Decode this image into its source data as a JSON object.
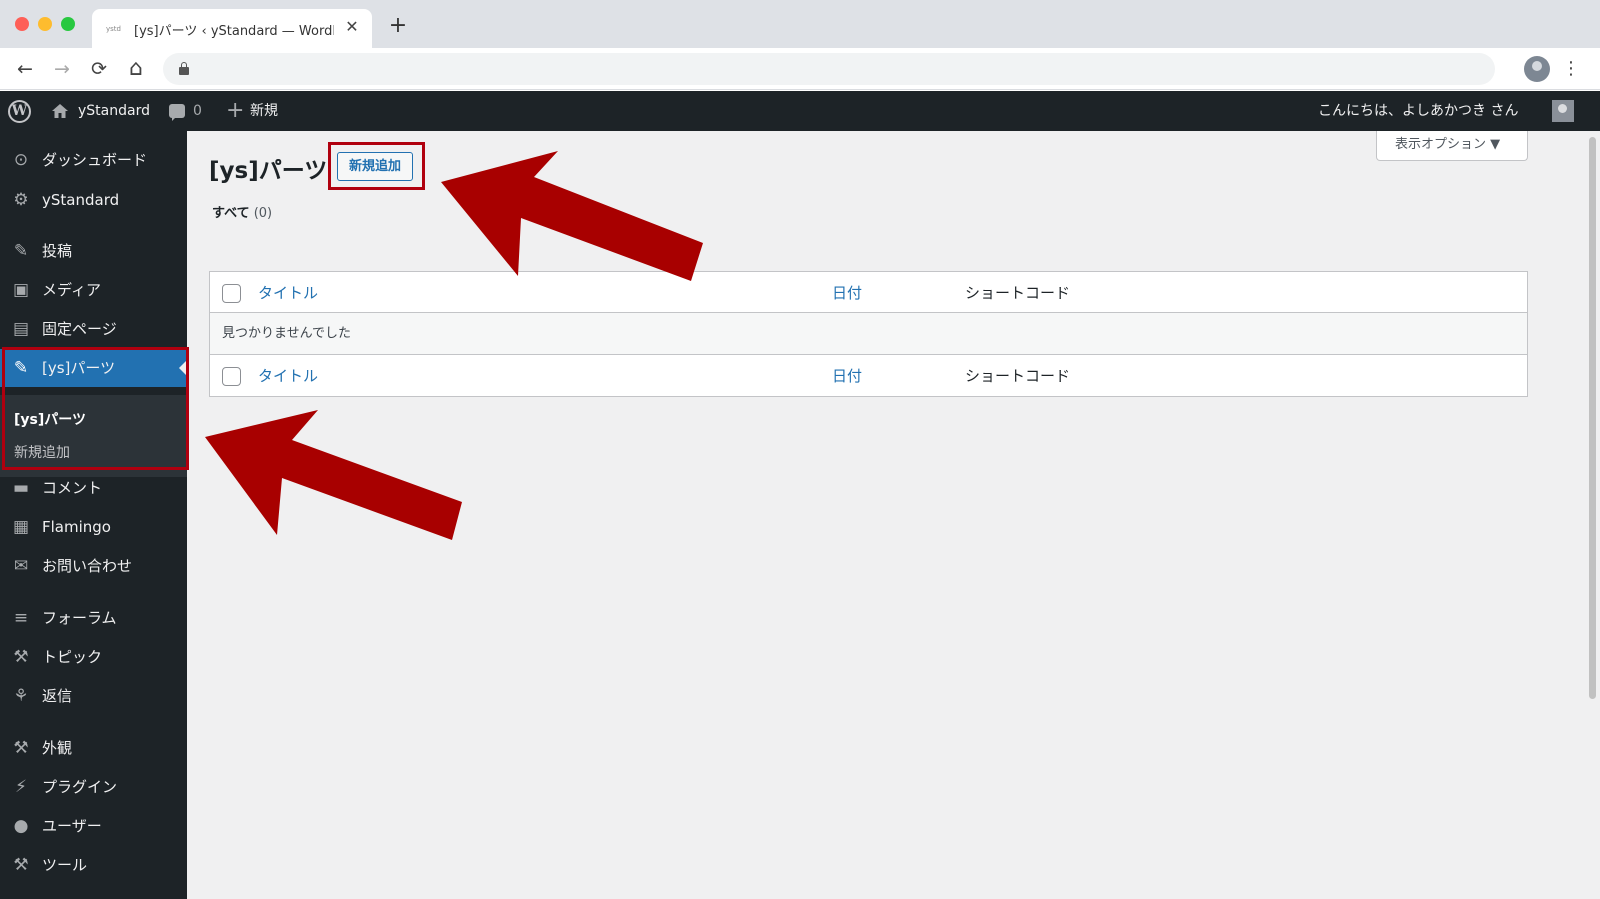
{
  "browser": {
    "tab_favicon_text": "ystd",
    "tab_title": "[ys]パーツ ‹ yStandard — WordPress",
    "tab_close": "✕",
    "new_tab": "+",
    "back": "←",
    "forward": "→",
    "reload": "⟳",
    "home": "⌂",
    "star": "☆",
    "menu": "⋮"
  },
  "adminbar": {
    "wp_logo": "W",
    "site_name": "yStandard",
    "comments_count": "0",
    "new_label": "新規",
    "greeting": "こんにちは、よしあかつき さん"
  },
  "sidebar": {
    "items": [
      {
        "label": "ダッシュボード",
        "icon": "⊙"
      },
      {
        "label": "yStandard",
        "icon": "⚙"
      },
      {
        "label": "投稿",
        "icon": "✎"
      },
      {
        "label": "メディア",
        "icon": "▣"
      },
      {
        "label": "固定ページ",
        "icon": "▤"
      },
      {
        "label": "[ys]パーツ",
        "icon": "✎"
      },
      {
        "label": "コメント",
        "icon": "▬"
      },
      {
        "label": "Flamingo",
        "icon": "▦"
      },
      {
        "label": "お問い合わせ",
        "icon": "✉"
      },
      {
        "label": "フォーラム",
        "icon": "≡"
      },
      {
        "label": "トピック",
        "icon": "⚒"
      },
      {
        "label": "返信",
        "icon": "⚘"
      },
      {
        "label": "外観",
        "icon": "⚒"
      },
      {
        "label": "プラグイン",
        "icon": "⚡"
      },
      {
        "label": "ユーザー",
        "icon": "●"
      },
      {
        "label": "ツール",
        "icon": "⚒"
      }
    ],
    "submenu": {
      "current": "[ys]パーツ",
      "add_new": "新規追加"
    }
  },
  "main": {
    "screen_options": "表示オプション ▼",
    "page_title": "[ys]パーツ",
    "add_new_button": "新規追加",
    "filter_all": "すべて",
    "filter_count": "(0)",
    "table": {
      "col_title": "タイトル",
      "col_date": "日付",
      "col_shortcode": "ショートコード",
      "empty_message": "見つかりませんでした"
    }
  },
  "annotation_color": "#b0000f"
}
